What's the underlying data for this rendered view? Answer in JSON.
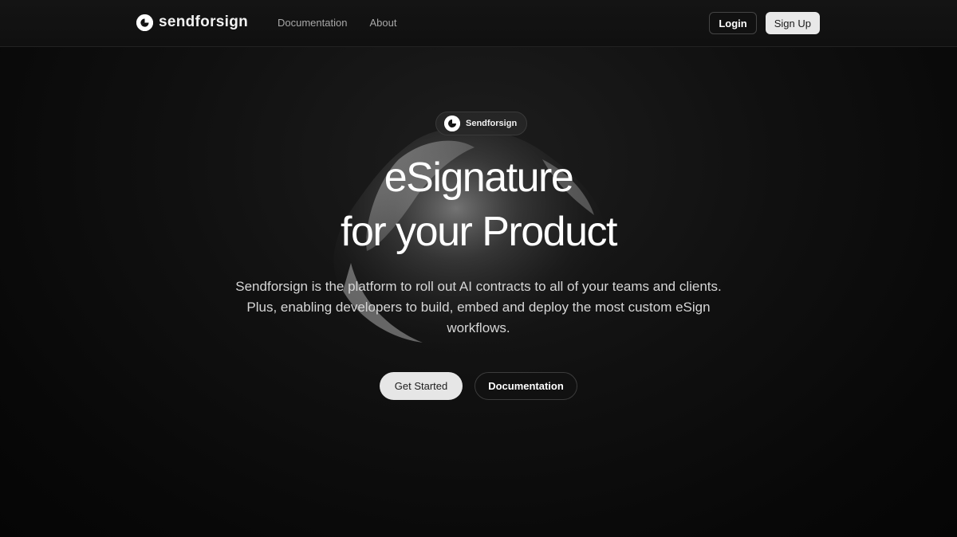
{
  "brand": {
    "name": "sendforsign",
    "logo_icon": "play-circle-icon"
  },
  "nav": {
    "items": [
      {
        "label": "Documentation"
      },
      {
        "label": "About"
      }
    ]
  },
  "auth": {
    "login_label": "Login",
    "signup_label": "Sign Up"
  },
  "hero": {
    "badge_label": "Sendforsign",
    "headline_line1": "eSignature",
    "headline_line2": "for your Product",
    "subtitle": "Sendforsign is the platform to roll out AI contracts to all of your teams and clients. Plus, enabling developers to build, embed and deploy the most custom eSign workflows.",
    "primary_cta": "Get Started",
    "secondary_cta": "Documentation"
  },
  "colors": {
    "background": "#0b0b0b",
    "text": "#ffffff",
    "muted": "#a8a8a8",
    "button_light": "#e6e6e6"
  }
}
